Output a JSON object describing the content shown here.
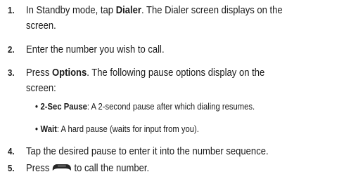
{
  "steps": [
    {
      "num": "1.",
      "pre": "In Standby mode, tap ",
      "bold": "Dialer",
      "post": ". The Dialer screen displays on the",
      "line2": "screen."
    },
    {
      "num": "2.",
      "text": "Enter the number you wish to call."
    },
    {
      "num": "3.",
      "pre": "Press ",
      "bold": "Options",
      "post": ". The following pause options display on the",
      "line2": "screen:",
      "bullets": [
        {
          "bullet": "•",
          "bold": "2-Sec Pause",
          "text": ": A 2-second pause after which dialing resumes."
        },
        {
          "bullet": "•",
          "bold": "Wait",
          "text": ": A hard pause (waits for input from you)."
        }
      ]
    },
    {
      "num": "4.",
      "text": "Tap the desired pause to enter it into the number sequence."
    },
    {
      "num": "5.",
      "pre": "Press",
      "icon": "call-key-icon",
      "post": "to call the number."
    }
  ]
}
